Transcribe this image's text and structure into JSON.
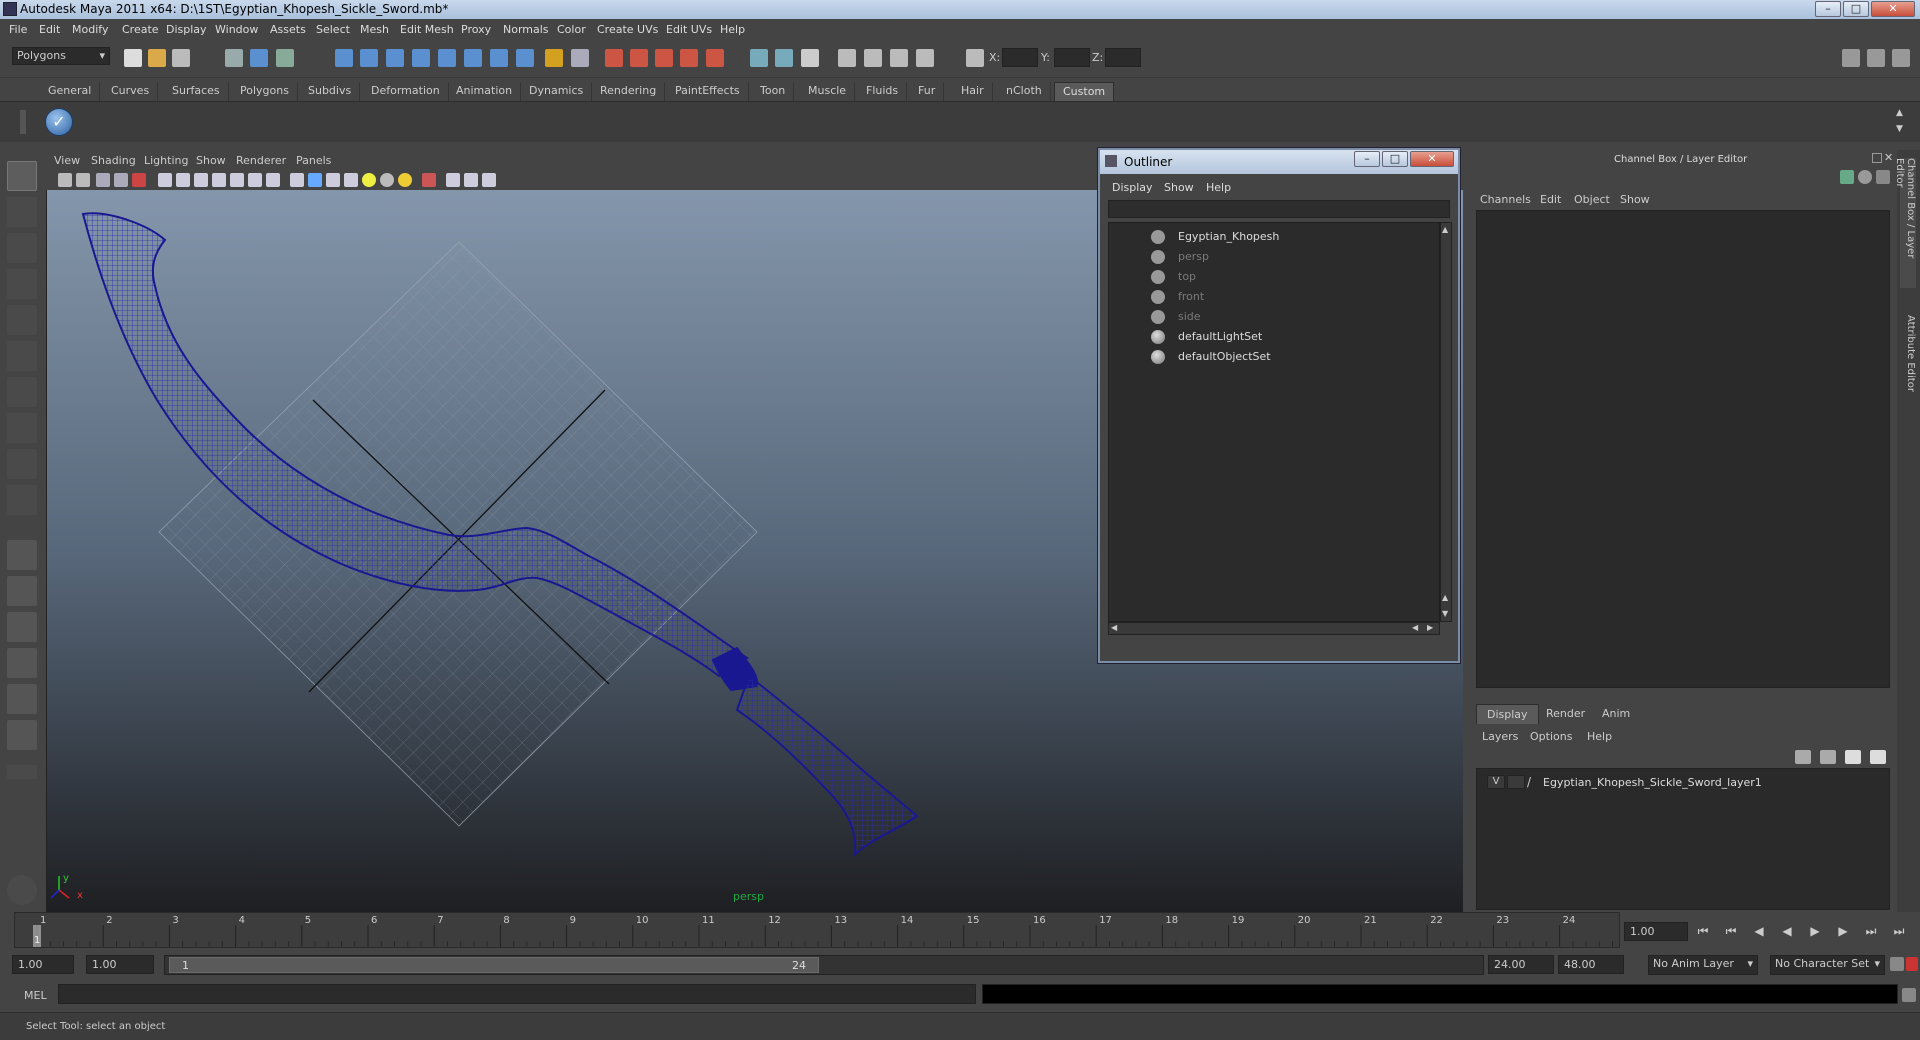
{
  "window": {
    "title": "Autodesk Maya 2011 x64: D:\\1ST\\Egyptian_Khopesh_Sickle_Sword.mb*"
  },
  "menubar": [
    "File",
    "Edit",
    "Modify",
    "Create",
    "Display",
    "Window",
    "Assets",
    "Select",
    "Mesh",
    "Edit Mesh",
    "Proxy",
    "Normals",
    "Color",
    "Create UVs",
    "Edit UVs",
    "Help"
  ],
  "toolbar": {
    "mode": "Polygons",
    "x_label": "X:",
    "y_label": "Y:",
    "z_label": "Z:"
  },
  "shelf_tabs": [
    "General",
    "Curves",
    "Surfaces",
    "Polygons",
    "Subdivs",
    "Deformation",
    "Animation",
    "Dynamics",
    "Rendering",
    "PaintEffects",
    "Toon",
    "Muscle",
    "Fluids",
    "Fur",
    "Hair",
    "nCloth",
    "Custom"
  ],
  "shelf_active": "Custom",
  "viewport": {
    "menu": [
      "View",
      "Shading",
      "Lighting",
      "Show",
      "Renderer",
      "Panels"
    ],
    "camera_label": "persp"
  },
  "outliner": {
    "title": "Outliner",
    "menu": [
      "Display",
      "Show",
      "Help"
    ],
    "items": [
      {
        "label": "Egyptian_Khopesh",
        "dim": false
      },
      {
        "label": "persp",
        "dim": true
      },
      {
        "label": "top",
        "dim": true
      },
      {
        "label": "front",
        "dim": true
      },
      {
        "label": "side",
        "dim": true
      },
      {
        "label": "defaultLightSet",
        "dim": false
      },
      {
        "label": "defaultObjectSet",
        "dim": false
      }
    ]
  },
  "channelbox": {
    "title": "Channel Box / Layer Editor",
    "menu": [
      "Channels",
      "Edit",
      "Object",
      "Show"
    ],
    "layer_tabs": [
      "Display",
      "Render",
      "Anim"
    ],
    "layer_menu": [
      "Layers",
      "Options",
      "Help"
    ],
    "layer": {
      "visibility": "V",
      "name": "Egyptian_Khopesh_Sickle_Sword_layer1"
    },
    "side_tabs": [
      "Channel Box / Layer Editor",
      "Attribute Editor"
    ]
  },
  "timeline": {
    "ticks": [
      "1",
      "2",
      "3",
      "4",
      "5",
      "6",
      "7",
      "8",
      "9",
      "10",
      "11",
      "12",
      "13",
      "14",
      "15",
      "16",
      "17",
      "18",
      "19",
      "20",
      "21",
      "22",
      "23",
      "24"
    ],
    "current_frame": "1",
    "current_time": "1.00"
  },
  "range": {
    "start": "1.00",
    "playback_start": "1.00",
    "slider_start": "1",
    "slider_end": "24",
    "playback_end": "24.00",
    "end": "48.00",
    "anim_layer": "No Anim Layer",
    "char_set": "No Character Set"
  },
  "cmd": {
    "label": "MEL"
  },
  "help": {
    "text": "Select Tool: select an object"
  }
}
